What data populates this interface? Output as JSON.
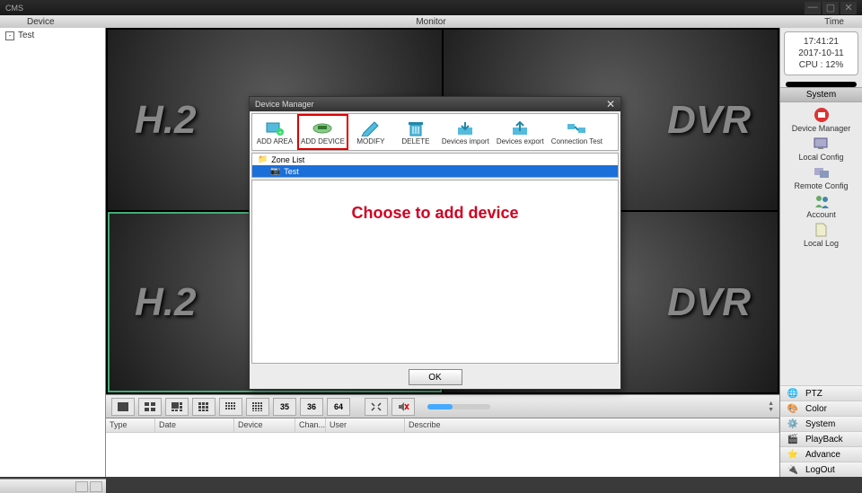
{
  "app_title": "CMS",
  "menubar": {
    "device": "Device",
    "monitor": "Monitor",
    "time": "Time"
  },
  "tree": {
    "root": "Test"
  },
  "video": {
    "brand_left": "H.2",
    "brand_right": "DVR"
  },
  "clock": {
    "time": "17:41:21",
    "date": "2017-10-11",
    "cpu": "CPU : 12%"
  },
  "system": {
    "header": "System",
    "items": [
      "Device Manager",
      "Local Config",
      "Remote Config",
      "Account",
      "Local Log"
    ]
  },
  "right_menu": [
    "PTZ",
    "Color",
    "System",
    "PlayBack",
    "Advance",
    "LogOut"
  ],
  "layout_buttons": [
    "35",
    "36",
    "64"
  ],
  "table_headers": [
    "Type",
    "Date",
    "Device",
    "Chan...",
    "User",
    "Describe"
  ],
  "dialog": {
    "title": "Device Manager",
    "tools": [
      "ADD AREA",
      "ADD DEVICE",
      "MODIFY",
      "DELETE",
      "Devices import",
      "Devices export",
      "Connection Test"
    ],
    "tree_root": "Zone List",
    "tree_child": "Test",
    "message": "Choose to add device",
    "ok": "OK"
  }
}
